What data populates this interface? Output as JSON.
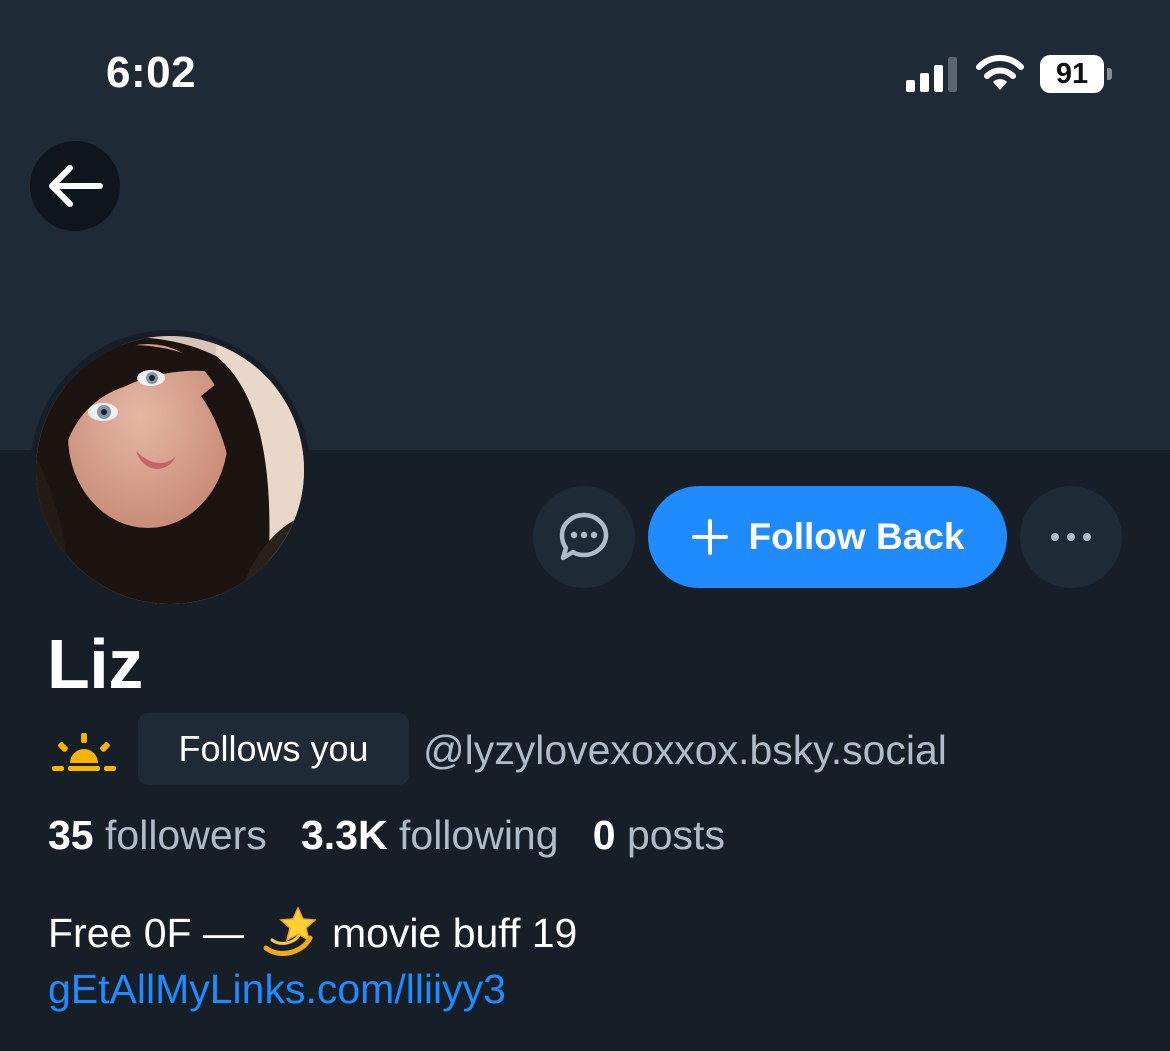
{
  "status_bar": {
    "time": "6:02",
    "battery_level": "91",
    "icons": [
      "signal-icon",
      "wifi-icon",
      "battery-icon"
    ]
  },
  "header": {
    "back_icon": "arrow-left-icon"
  },
  "profile": {
    "display_name": "Liz",
    "name_emoji": "sunrise-emoji",
    "follows_you_badge": "Follows you",
    "handle": "@lyzylovexoxxox.bsky.social",
    "stats": {
      "followers_count": "35",
      "followers_label": "followers",
      "following_count": "3.3K",
      "following_label": "following",
      "posts_count": "0",
      "posts_label": "posts"
    },
    "bio_before_emoji": "Free 0F —",
    "bio_emoji": "dizzy-star-emoji",
    "bio_after_emoji": "movie buff 19",
    "link": "gEtAllMyLinks.com/lliiyy3"
  },
  "actions": {
    "message_icon": "chat-bubble-icon",
    "follow_label": "Follow Back",
    "follow_icon": "plus-icon",
    "more_icon": "ellipsis-icon"
  },
  "colors": {
    "background": "#161e27",
    "banner": "#1f2a37",
    "accent": "#208bfe",
    "muted_text": "#aebbc9"
  }
}
